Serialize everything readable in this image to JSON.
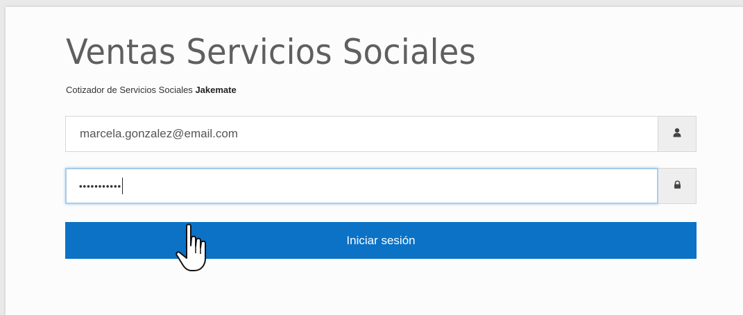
{
  "app": {
    "title": "Ventas Servicios Sociales",
    "subtitle_prefix": "Cotizador de Servicios Sociales",
    "subtitle_brand": "Jakemate"
  },
  "login": {
    "email_value": "marcela.gonzalez@email.com",
    "password_masked": "•••••••••••",
    "user_icon": "user-icon",
    "lock_icon": "lock-icon",
    "submit_label": "Iniciar sesión"
  },
  "colors": {
    "primary_button": "#0b72c6",
    "focus_border": "#a9cbe8",
    "title_text": "#5f5f5f"
  }
}
